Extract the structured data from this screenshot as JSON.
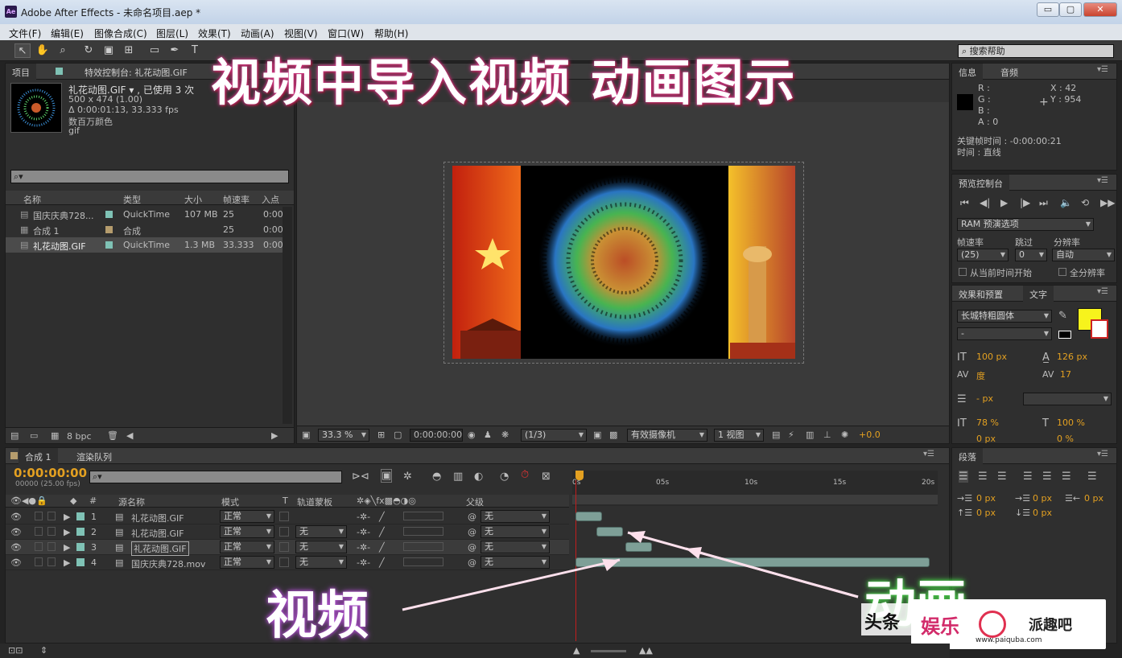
{
  "app": {
    "title": "Adobe After Effects - 未命名项目.aep *",
    "logo": "Ae",
    "window_buttons": [
      "▭",
      "▢",
      "✕"
    ]
  },
  "menu": [
    "文件(F)",
    "编辑(E)",
    "图像合成(C)",
    "图层(L)",
    "效果(T)",
    "动画(A)",
    "视图(V)",
    "窗口(W)",
    "帮助(H)"
  ],
  "search": {
    "placeholder": "搜索帮助"
  },
  "overlays": {
    "top_caption": "视频中导入视频  动画图示",
    "video_label": "视频",
    "anim_label": "动画",
    "watermark_left": "头条",
    "watermark_logo": "娱乐",
    "watermark_site": "派趣吧",
    "watermark_url": "www.paiquba.com"
  },
  "project": {
    "tab_project": "项目",
    "tab_effects": "特效控制台: 礼花动图.GIF",
    "selected_name": "礼花动图.GIF ▾ , 已使用 3 次",
    "info_lines": [
      "500 x 474 (1.00)",
      "Δ 0:00:01:13, 33.333 fps",
      "数百万颜色",
      "gif"
    ],
    "columns": [
      "名称",
      "类型",
      "大小",
      "帧速率",
      "入点"
    ],
    "items": [
      {
        "name": "国庆庆典728...",
        "type": "QuickTime",
        "size": "107 MB",
        "fps": "25",
        "in": "0:00",
        "color": "#7fc2b5"
      },
      {
        "name": "合成 1",
        "type": "合成",
        "size": "",
        "fps": "25",
        "in": "0:00",
        "color": "#b59c6d"
      },
      {
        "name": "礼花动图.GIF",
        "type": "QuickTime",
        "size": "1.3 MB",
        "fps": "33.333",
        "in": "0:00",
        "color": "#7fc2b5"
      }
    ],
    "footer_bpc": "8 bpc"
  },
  "viewer": {
    "zoom": "33.3 %",
    "timecode": "0:00:00:00",
    "resolution": "(1/3)",
    "camera": "有效摄像机",
    "views": "1 视图",
    "exposure": "+0.0"
  },
  "info_panel": {
    "tab_info": "信息",
    "tab_audio": "音频",
    "r": "R :",
    "g": "G :",
    "b": "B :",
    "a": "A : 0",
    "x": "X : 42",
    "y": "Y : 954",
    "keyframe": "关键帧时间 : -0:00:00:21",
    "time": "时间 : 直线"
  },
  "preview": {
    "tab": "预览控制台",
    "ram": "RAM 预演选项",
    "fps_label": "帧速率",
    "skip_label": "跳过",
    "res_label": "分辨率",
    "fps_val": "(25)",
    "skip_val": "0",
    "res_val": "自动",
    "from_current": "从当前时间开始",
    "full_screen": "全分辨率"
  },
  "character": {
    "tab_effects": "效果和预置",
    "tab_text": "文字",
    "font": "长城特粗圆体",
    "style": "-",
    "size": "100 px",
    "leading": "126 px",
    "kerning": "度",
    "tracking": "17",
    "stroke": "- px",
    "vscale": "78 %",
    "hscale": "100 %",
    "baseline": "0 px",
    "tsume": "0 %",
    "fill_color": "#f7f31c"
  },
  "paragraph": {
    "tab": "段落",
    "indent_left": "0 px",
    "indent_first": "0 px",
    "indent_right": "0 px",
    "space_before": "0 px",
    "space_after": "0 px"
  },
  "timeline": {
    "tab_comp": "合成 1",
    "tab_render": "渲染队列",
    "timecode": "0:00:00:00",
    "frame_info": "00000 (25.00 fps)",
    "col_source": "源名称",
    "col_mode": "模式",
    "col_t": "T",
    "col_track": "轨道蒙板",
    "col_parent": "父级",
    "ruler": [
      "0s",
      "05s",
      "10s",
      "15s",
      "20s"
    ],
    "layers": [
      {
        "num": "1",
        "name": "礼花动图.GIF",
        "mode": "正常",
        "track": "",
        "parent": "无",
        "color": "#7fc2b5",
        "start": 0.0,
        "end": 1.5
      },
      {
        "num": "2",
        "name": "礼花动图.GIF",
        "mode": "正常",
        "track": "无",
        "parent": "无",
        "color": "#7fc2b5",
        "start": 1.2,
        "end": 2.7
      },
      {
        "num": "3",
        "name": "礼花动图.GIF",
        "mode": "正常",
        "track": "无",
        "parent": "无",
        "color": "#7fc2b5",
        "start": 2.8,
        "end": 4.3
      },
      {
        "num": "4",
        "name": "国庆庆典728.mov",
        "mode": "正常",
        "track": "无",
        "parent": "无",
        "color": "#7fc2b5",
        "start": 0.0,
        "end": 20.0
      }
    ]
  }
}
